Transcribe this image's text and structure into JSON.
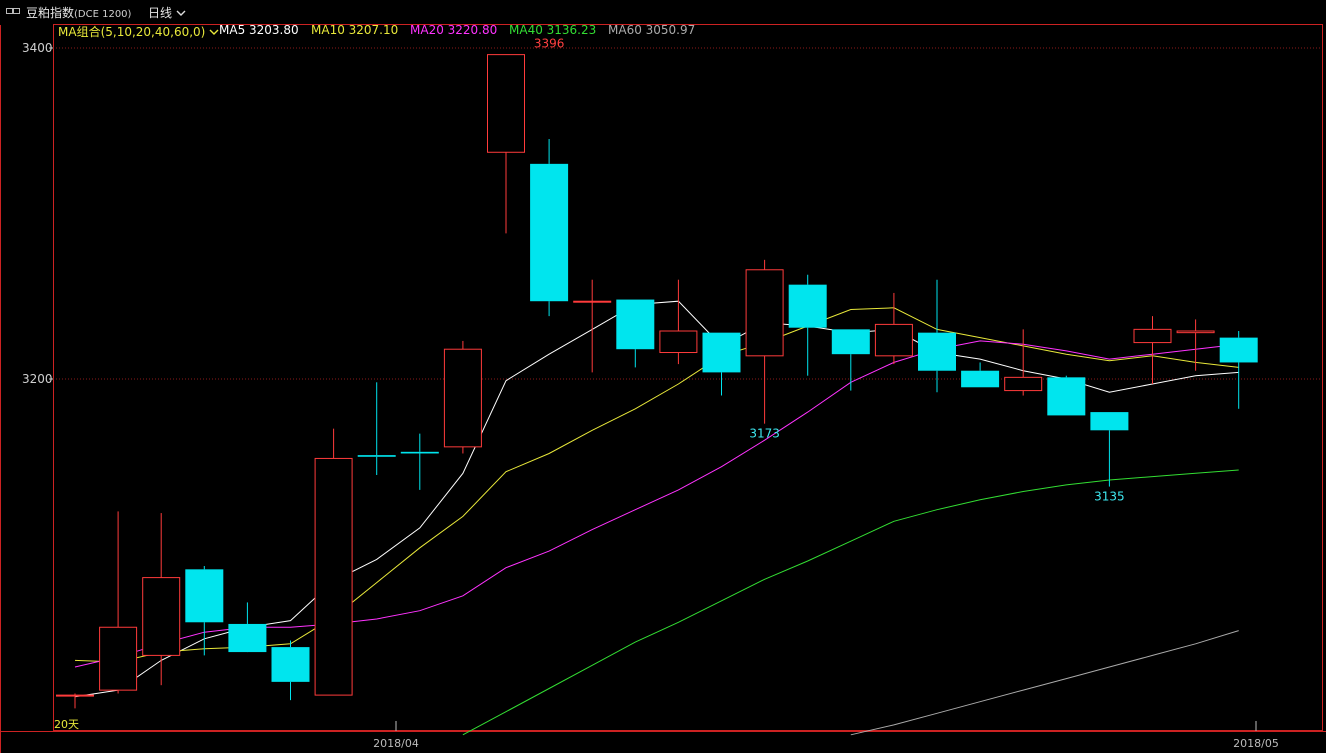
{
  "header": {
    "instrument": "豆粕指数",
    "instrument_code": "(DCE 1200)",
    "period": "日线"
  },
  "ma_legend": {
    "group_label": "MA组合(5,10,20,40,60,0)",
    "items": [
      {
        "label": "MA5 3203.80",
        "color": "#ffffff"
      },
      {
        "label": "MA10 3207.10",
        "color": "#e8e83a"
      },
      {
        "label": "MA20 3220.80",
        "color": "#ff33ff"
      },
      {
        "label": "MA40 3136.23",
        "color": "#33dd33"
      },
      {
        "label": "MA60 3050.97",
        "color": "#aaaaaa"
      }
    ]
  },
  "chart_data": {
    "type": "candlestick",
    "y_ticks": [
      3400,
      3200
    ],
    "ylim": [
      2985,
      3420
    ],
    "x_labels": [
      "2018/04",
      "2018/05"
    ],
    "colors": {
      "up": "#ff3b3b",
      "down": "#00e5ee",
      "border": "#cc2222",
      "grid": "#8a1a1a"
    },
    "annotations": [
      {
        "text": "3396",
        "candle": 11,
        "price": 3396,
        "color": "#ff4040",
        "pos": "above"
      },
      {
        "text": "3173",
        "candle": 16,
        "price": 3173,
        "color": "#3ee8f0",
        "pos": "below"
      },
      {
        "text": "3135",
        "candle": 24,
        "price": 3135,
        "color": "#3ee8f0",
        "pos": "below"
      }
    ],
    "corner_label": "20天",
    "candles": [
      {
        "o": 3009,
        "h": 3010,
        "l": 3001,
        "c": 3009
      },
      {
        "o": 3012,
        "h": 3120,
        "l": 3010,
        "c": 3050
      },
      {
        "o": 3033,
        "h": 3119,
        "l": 3015,
        "c": 3080
      },
      {
        "o": 3085,
        "h": 3087,
        "l": 3033,
        "c": 3053
      },
      {
        "o": 3052,
        "h": 3065,
        "l": 3040,
        "c": 3035
      },
      {
        "o": 3038,
        "h": 3042,
        "l": 3006,
        "c": 3017
      },
      {
        "o": 3009,
        "h": 3170,
        "l": 3009,
        "c": 3152
      },
      {
        "o": 3154,
        "h": 3198,
        "l": 3142,
        "c": 3153
      },
      {
        "o": 3156,
        "h": 3167,
        "l": 3133,
        "c": 3155
      },
      {
        "o": 3159,
        "h": 3223,
        "l": 3155,
        "c": 3218
      },
      {
        "o": 3337,
        "h": 3396,
        "l": 3288,
        "c": 3396
      },
      {
        "o": 3330,
        "h": 3345,
        "l": 3238,
        "c": 3247
      },
      {
        "o": 3247,
        "h": 3260,
        "l": 3204,
        "c": 3247
      },
      {
        "o": 3248,
        "h": 3248,
        "l": 3207,
        "c": 3218
      },
      {
        "o": 3216,
        "h": 3260,
        "l": 3209,
        "c": 3229
      },
      {
        "o": 3228,
        "h": 3228,
        "l": 3190,
        "c": 3204
      },
      {
        "o": 3214,
        "h": 3272,
        "l": 3173,
        "c": 3266
      },
      {
        "o": 3257,
        "h": 3263,
        "l": 3202,
        "c": 3231
      },
      {
        "o": 3230,
        "h": 3230,
        "l": 3193,
        "c": 3215
      },
      {
        "o": 3214,
        "h": 3252,
        "l": 3209,
        "c": 3233
      },
      {
        "o": 3228,
        "h": 3260,
        "l": 3192,
        "c": 3205
      },
      {
        "o": 3205,
        "h": 3210,
        "l": 3195,
        "c": 3195
      },
      {
        "o": 3193,
        "h": 3230,
        "l": 3190,
        "c": 3201
      },
      {
        "o": 3201,
        "h": 3202,
        "l": 3178,
        "c": 3178
      },
      {
        "o": 3180,
        "h": 3180,
        "l": 3135,
        "c": 3169
      },
      {
        "o": 3222,
        "h": 3238,
        "l": 3197,
        "c": 3230
      },
      {
        "o": 3228,
        "h": 3236,
        "l": 3205,
        "c": 3229
      },
      {
        "o": 3225,
        "h": 3229,
        "l": 3182,
        "c": 3210
      }
    ],
    "series": [
      {
        "name": "MA5",
        "color": "#ffffff",
        "values": [
          3008,
          3012,
          3030,
          3043,
          3050,
          3054,
          3078,
          3091,
          3110,
          3143,
          3199,
          3215,
          3230,
          3245,
          3247,
          3220,
          3234,
          3232,
          3228,
          3230,
          3216,
          3212,
          3205,
          3200,
          3192,
          3197,
          3202,
          3204
        ]
      },
      {
        "name": "MA10",
        "color": "#e8e83a",
        "values": [
          3030,
          3029,
          3035,
          3037,
          3038,
          3040,
          3056,
          3077,
          3098,
          3117,
          3144,
          3155,
          3169,
          3182,
          3197,
          3214,
          3222,
          3232,
          3242,
          3243,
          3230,
          3225,
          3220,
          3215,
          3211,
          3214,
          3210,
          3207
        ]
      },
      {
        "name": "MA20",
        "color": "#ff33ff",
        "values": [
          3026,
          3032,
          3040,
          3047,
          3050,
          3050,
          3052,
          3055,
          3060,
          3069,
          3086,
          3096,
          3109,
          3121,
          3133,
          3147,
          3163,
          3180,
          3198,
          3210,
          3218,
          3223,
          3221,
          3217,
          3212,
          3215,
          3218,
          3221
        ]
      },
      {
        "name": "MA40",
        "color": "#33dd33",
        "values": [
          null,
          null,
          null,
          null,
          null,
          null,
          null,
          null,
          null,
          2985,
          2999,
          3013,
          3027,
          3041,
          3053,
          3066,
          3079,
          3090,
          3102,
          3114,
          3121,
          3127,
          3132,
          3136,
          3139,
          3141,
          3143,
          3145
        ]
      },
      {
        "name": "MA60",
        "color": "#aaaaaa",
        "values": [
          null,
          null,
          null,
          null,
          null,
          null,
          null,
          null,
          null,
          null,
          null,
          null,
          null,
          null,
          null,
          null,
          null,
          null,
          2985,
          2991,
          2998,
          3005,
          3012,
          3019,
          3026,
          3033,
          3040,
          3048
        ]
      }
    ]
  }
}
